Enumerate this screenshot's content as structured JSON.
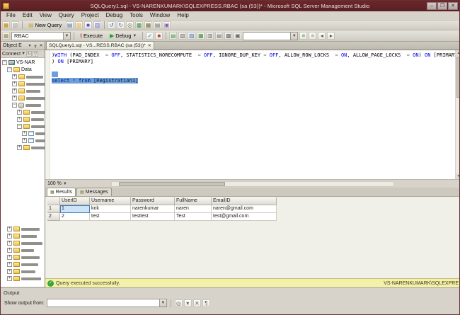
{
  "window": {
    "title": "SQLQuery1.sql - VS-NARENKUMARK\\SQLEXPRESS.RBAC (sa (53))* - Microsoft SQL Server Management Studio",
    "controls": [
      {
        "name": "minimize-button",
        "glyph": "–"
      },
      {
        "name": "maximize-button",
        "glyph": "❐"
      },
      {
        "name": "close-button",
        "glyph": "✕"
      }
    ]
  },
  "menu": {
    "items": [
      "File",
      "Edit",
      "View",
      "Query",
      "Project",
      "Debug",
      "Tools",
      "Window",
      "Help"
    ]
  },
  "toolbar_main": {
    "icons_left": [
      {
        "name": "connect-object-explorer-icon",
        "glyph": "▦",
        "fg": "#b8860b"
      },
      {
        "name": "disconnect-icon",
        "glyph": "▧",
        "fg": "#8a8a8a"
      }
    ],
    "new_query_label": "New Query",
    "icons_mid": [
      {
        "name": "new-file-icon",
        "glyph": "▤",
        "fg": "#4a6fa5"
      },
      {
        "name": "open-file-icon",
        "glyph": "▨",
        "fg": "#d8a528"
      },
      {
        "name": "save-icon",
        "glyph": "■",
        "fg": "#5a4fcf"
      },
      {
        "name": "save-all-icon",
        "glyph": "▥",
        "fg": "#5a4fcf"
      }
    ],
    "icons_right": [
      {
        "name": "undo-icon",
        "glyph": "↺",
        "fg": "#3b6fb5"
      },
      {
        "name": "redo-icon",
        "glyph": "↻",
        "fg": "#3b6fb5"
      },
      {
        "name": "find-icon",
        "glyph": "◎",
        "fg": "#666666"
      },
      {
        "name": "activity-monitor-icon",
        "glyph": "▩",
        "fg": "#3d8c40"
      },
      {
        "name": "solution-explorer-icon",
        "glyph": "▦",
        "fg": "#7a6a3a"
      },
      {
        "name": "properties-window-icon",
        "glyph": "▤",
        "fg": "#666666"
      },
      {
        "name": "template-explorer-icon",
        "glyph": "▣",
        "fg": "#8a5fa0"
      }
    ]
  },
  "toolbar_sql": {
    "lead_icons": [
      {
        "name": "available-databases-icon",
        "glyph": "▦",
        "fg": "#9a8a4a"
      }
    ],
    "database": "RBAC",
    "execute_label": "Execute",
    "debug_label": "Debug",
    "exec_icons": [
      {
        "name": "parse-query-icon",
        "glyph": "✓",
        "fg": "#2e75b6"
      },
      {
        "name": "cancel-query-icon",
        "glyph": "■",
        "fg": "#b04a3a"
      }
    ],
    "mid_icons": [
      {
        "name": "show-estimated-plan-icon",
        "glyph": "▤",
        "fg": "#3d8c40"
      },
      {
        "name": "query-options-icon",
        "glyph": "▧",
        "fg": "#666666"
      },
      {
        "name": "intellisense-enabled-icon",
        "glyph": "▨",
        "fg": "#3b6fb5"
      },
      {
        "name": "include-actual-plan-icon",
        "glyph": "▦",
        "fg": "#3d8c40"
      },
      {
        "name": "include-client-statistics-icon",
        "glyph": "▥",
        "fg": "#666666"
      },
      {
        "name": "results-to-text-icon",
        "glyph": "▤",
        "fg": "#666666"
      },
      {
        "name": "results-to-grid-icon",
        "glyph": "▩",
        "fg": "#666666"
      },
      {
        "name": "results-to-file-icon",
        "glyph": "▣",
        "fg": "#666666"
      }
    ],
    "second_combo_value": "",
    "right_icons": [
      {
        "name": "comment-selection-icon",
        "glyph": "≡",
        "fg": "#3d8c40"
      },
      {
        "name": "uncomment-selection-icon",
        "glyph": "≡",
        "fg": "#8a8a8a"
      },
      {
        "name": "decrease-indent-icon",
        "glyph": "◂",
        "fg": "#555555"
      },
      {
        "name": "increase-indent-icon",
        "glyph": "▸",
        "fg": "#555555"
      }
    ]
  },
  "object_explorer": {
    "title": "Object E",
    "header_icons": [
      {
        "name": "window-position-icon",
        "glyph": "▾"
      },
      {
        "name": "auto-hide-pin-icon",
        "glyph": "┰"
      },
      {
        "name": "close-icon",
        "glyph": "✕"
      }
    ],
    "connect_label": "Connect",
    "connect_icons": [
      {
        "name": "refresh-icon",
        "glyph": "↻"
      },
      {
        "name": "filter-icon",
        "glyph": "▽"
      }
    ],
    "tree": [
      {
        "level": 0,
        "icon": "server",
        "expand": "minus",
        "label": "VS-NAR"
      },
      {
        "level": 1,
        "icon": "folder",
        "expand": "minus",
        "label": "Data"
      },
      {
        "level": 2,
        "icon": "folder",
        "expand": "plus",
        "label": ""
      },
      {
        "level": 2,
        "icon": "folder",
        "expand": "plus",
        "label": ""
      },
      {
        "level": 2,
        "icon": "folder",
        "expand": "plus",
        "label": ""
      },
      {
        "level": 2,
        "icon": "folder",
        "expand": "plus",
        "label": ""
      },
      {
        "level": 2,
        "icon": "database",
        "expand": "minus",
        "label": ""
      },
      {
        "level": 3,
        "icon": "folder",
        "expand": "plus",
        "label": ""
      },
      {
        "level": 3,
        "icon": "folder",
        "expand": "plus",
        "label": ""
      },
      {
        "level": 3,
        "icon": "folder",
        "expand": "minus",
        "label": ""
      },
      {
        "level": 4,
        "icon": "table",
        "expand": "plus",
        "label": ""
      },
      {
        "level": 4,
        "icon": "table",
        "expand": "plus",
        "label": ""
      },
      {
        "level": 3,
        "icon": "folder",
        "expand": "plus",
        "label": ""
      },
      {
        "level": 1,
        "icon": "folder",
        "expand": "plus",
        "label": "",
        "gap": true
      },
      {
        "level": 1,
        "icon": "folder",
        "expand": "plus",
        "label": ""
      },
      {
        "level": 1,
        "icon": "folder",
        "expand": "plus",
        "label": ""
      },
      {
        "level": 1,
        "icon": "folder",
        "expand": "plus",
        "label": ""
      },
      {
        "level": 1,
        "icon": "folder",
        "expand": "plus",
        "label": ""
      },
      {
        "level": 1,
        "icon": "folder",
        "expand": "plus",
        "label": ""
      },
      {
        "level": 1,
        "icon": "folder",
        "expand": "plus",
        "label": ""
      },
      {
        "level": 1,
        "icon": "folder",
        "expand": "plus",
        "label": ""
      }
    ]
  },
  "editor": {
    "tab_label": "SQLQuery1.sql - VS...RESS.RBAC (sa (53))*",
    "tab_close_glyph": "✕",
    "zoom": "100 %",
    "lines": [
      {
        "segments": [
          [
            ")",
            "pn"
          ],
          [
            "WITH",
            "kw"
          ],
          [
            " (",
            "pn"
          ],
          [
            "PAD_INDEX  ",
            "id"
          ],
          [
            "= ",
            "op"
          ],
          [
            "OFF",
            "kw"
          ],
          [
            ", ",
            "pn"
          ],
          [
            "STATISTICS_NORECOMPUTE  ",
            "id"
          ],
          [
            "= ",
            "op"
          ],
          [
            "OFF",
            "kw"
          ],
          [
            ", ",
            "pn"
          ],
          [
            "IGNORE_DUP_KEY ",
            "id"
          ],
          [
            "= ",
            "op"
          ],
          [
            "OFF",
            "kw"
          ],
          [
            ", ",
            "pn"
          ],
          [
            "ALLOW_ROW_LOCKS  ",
            "id"
          ],
          [
            "= ",
            "op"
          ],
          [
            "ON",
            "kw"
          ],
          [
            ", ",
            "pn"
          ],
          [
            "ALLOW_PAGE_LOCKS  ",
            "id"
          ],
          [
            "= ",
            "op"
          ],
          [
            "ON",
            "kw"
          ],
          [
            ") ",
            "pn"
          ],
          [
            "ON",
            "kw"
          ],
          [
            " [PRIMARY]",
            "id"
          ]
        ]
      },
      {
        "segments": [
          [
            ") ",
            "pn"
          ],
          [
            "ON",
            "kw"
          ],
          [
            " [PRIMARY]",
            "id"
          ]
        ]
      },
      {
        "segments": []
      },
      {
        "segments": [],
        "mini_selection": true
      },
      {
        "segments": [
          [
            "select",
            "kw"
          ],
          [
            " * ",
            "op"
          ],
          [
            "from",
            "kw"
          ],
          [
            " [Registration1]",
            "id"
          ]
        ],
        "selected": true
      }
    ]
  },
  "results": {
    "tabs": [
      {
        "label": "Results",
        "icon": "results-grid-icon",
        "glyph": "▦",
        "active": true
      },
      {
        "label": "Messages",
        "icon": "messages-icon",
        "glyph": "▤",
        "active": false
      }
    ],
    "grid": {
      "columns": [
        "UserID",
        "Username",
        "Password",
        "FullName",
        "EmailID"
      ],
      "rows": [
        {
          "num": "1",
          "cells": [
            "1",
            "knk",
            "narenkumar",
            "naren",
            "naren@gmail.com"
          ]
        },
        {
          "num": "2",
          "cells": [
            "2",
            "test",
            "testtest",
            "Test",
            "test@gmail.com"
          ]
        }
      ],
      "selected_cell": {
        "row": 0,
        "col": 0
      }
    }
  },
  "status_bar": {
    "message": "Query executed successfully.",
    "check_glyph": "✓",
    "server": "VS-NARENKUMARK\\SQLEXPRE"
  },
  "output": {
    "title": "Output",
    "show_output_label": "Show output from:",
    "combo_value": "",
    "icons": [
      {
        "name": "find-message-icon",
        "glyph": "◎"
      },
      {
        "name": "go-to-message-icon",
        "glyph": "▾"
      },
      {
        "name": "clear-all-icon",
        "glyph": "✕"
      },
      {
        "name": "toggle-word-wrap-icon",
        "glyph": "¶"
      }
    ]
  }
}
